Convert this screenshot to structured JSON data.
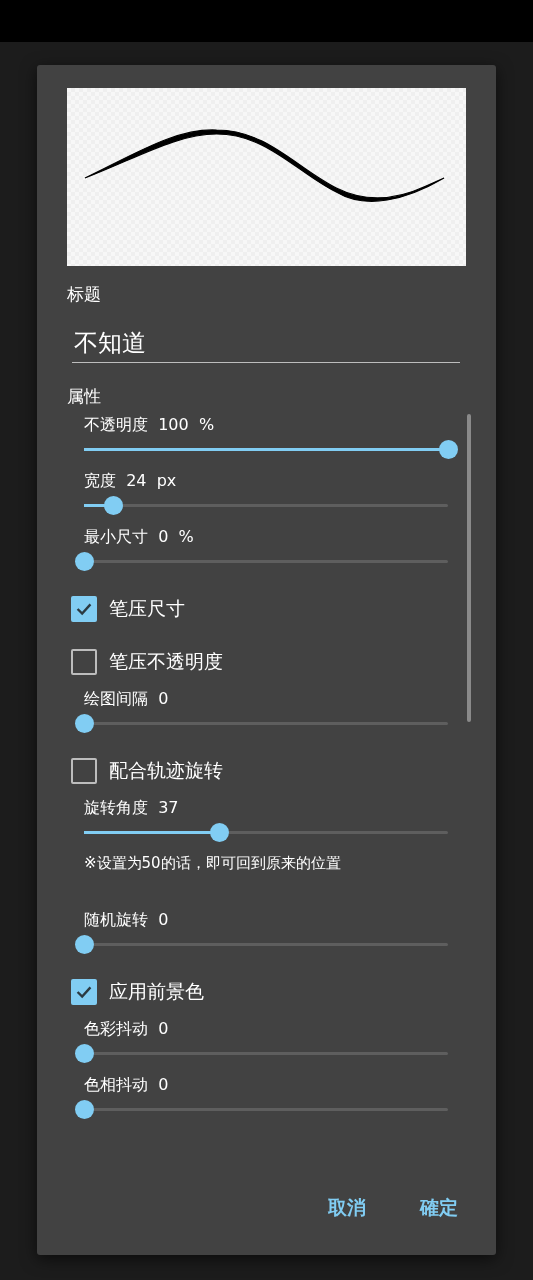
{
  "dialog": {
    "preview": {
      "kind": "stroke"
    },
    "title_label": "标题",
    "title_field": {
      "value": "不知道"
    },
    "section_label": "属性",
    "items": [
      {
        "kind": "slider",
        "label": "不透明度  100  %",
        "level": 1.0
      },
      {
        "kind": "slider",
        "label": "宽度  24  px",
        "level": 0.08
      },
      {
        "kind": "slider",
        "label": "最小尺寸  0  %",
        "level": 0.0
      },
      {
        "kind": "checkbox",
        "label": "笔压尺寸",
        "checked": true
      },
      {
        "kind": "checkbox",
        "label": "笔压不透明度",
        "checked": false
      },
      {
        "kind": "slider",
        "label": "绘图间隔  0",
        "level": 0.0
      },
      {
        "kind": "checkbox",
        "label": "配合轨迹旋转",
        "checked": false
      },
      {
        "kind": "slider",
        "label": "旋转角度  37",
        "level": 0.37
      },
      {
        "kind": "note",
        "label": "※设置为50的话，即可回到原来的位置"
      },
      {
        "kind": "slider",
        "label": "随机旋转  0",
        "level": 0.0
      },
      {
        "kind": "checkbox",
        "label": "应用前景色",
        "checked": true
      },
      {
        "kind": "slider",
        "label": "色彩抖动  0",
        "level": 0.0
      },
      {
        "kind": "slider",
        "label": "色相抖动  0",
        "level": 0.0
      }
    ],
    "buttons": [
      "取消",
      "確定"
    ]
  }
}
